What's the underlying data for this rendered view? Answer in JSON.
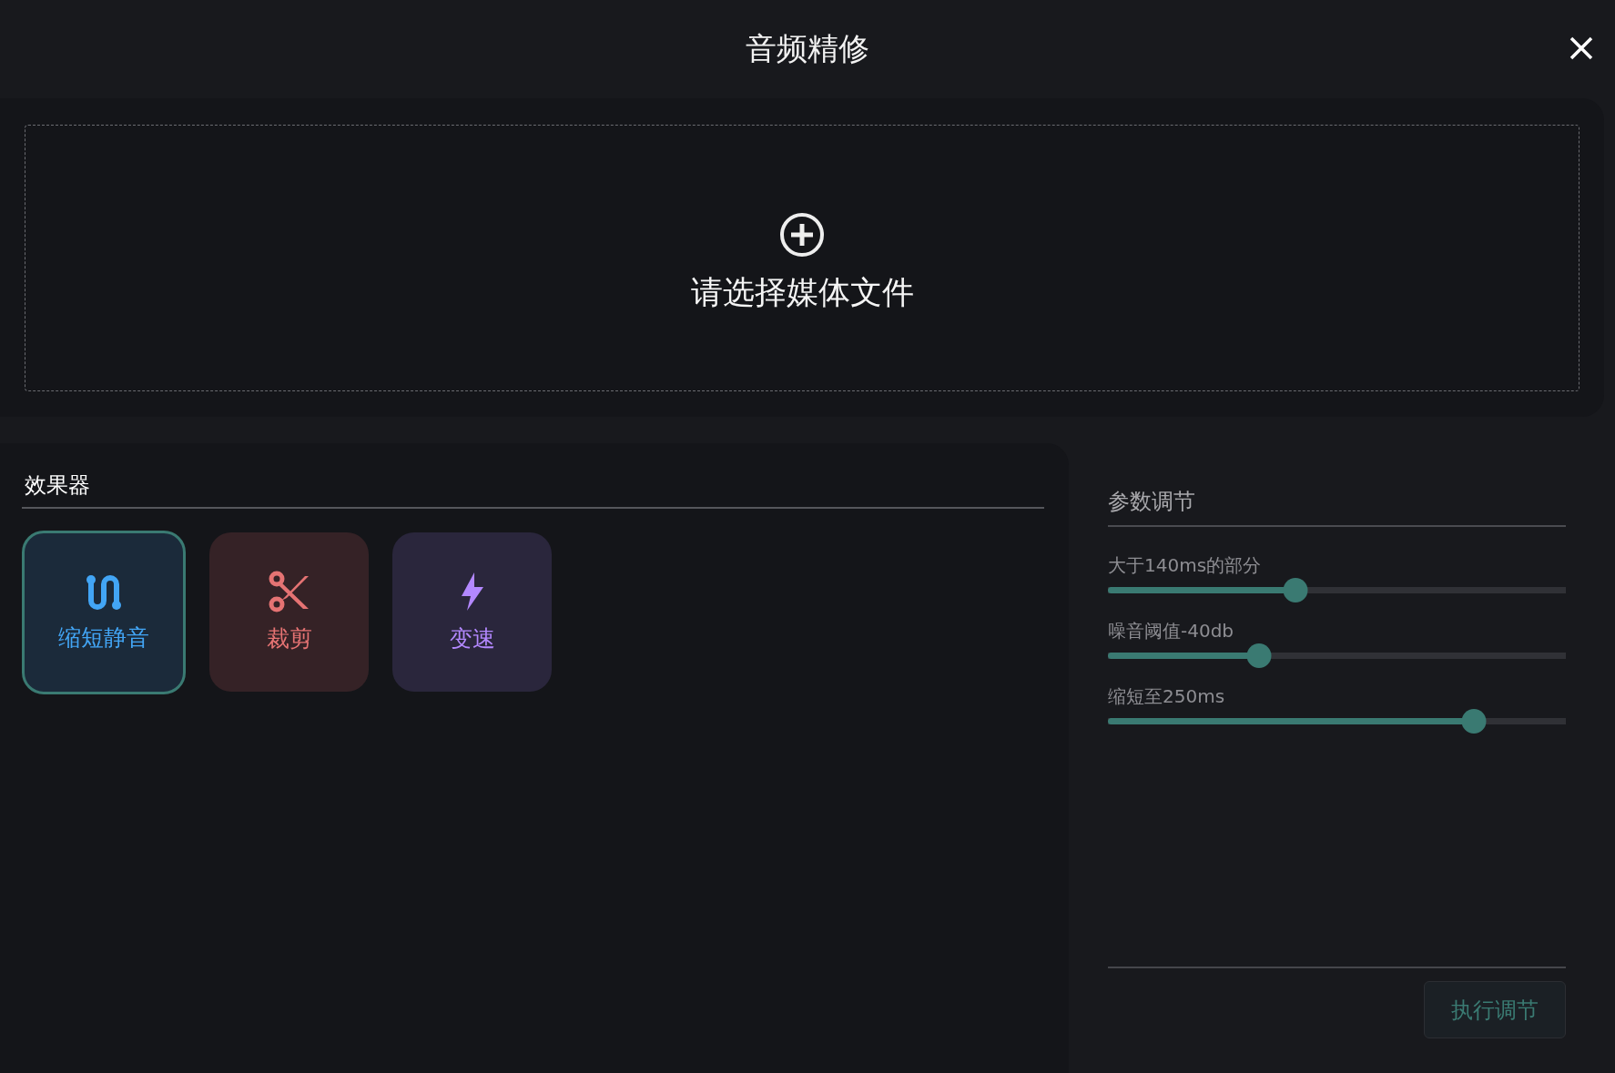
{
  "window": {
    "title": "音频精修"
  },
  "upload": {
    "label": "请选择媒体文件"
  },
  "effects": {
    "title": "效果器",
    "items": [
      {
        "kind": "silence",
        "label": "缩短静音",
        "color": "#42a5f5",
        "selected": true
      },
      {
        "kind": "cut",
        "label": "裁剪",
        "color": "#e57373",
        "selected": false
      },
      {
        "kind": "speed",
        "label": "变速",
        "color": "#b388ff",
        "selected": false
      }
    ]
  },
  "params": {
    "title": "参数调节",
    "sliders": [
      {
        "label": "大于140ms的部分",
        "level": 0.41
      },
      {
        "label": "噪音阈值-40db",
        "level": 0.33
      },
      {
        "label": "缩短至250ms",
        "level": 0.8
      }
    ],
    "button": {
      "label": "执行调节",
      "disabled": true
    }
  }
}
